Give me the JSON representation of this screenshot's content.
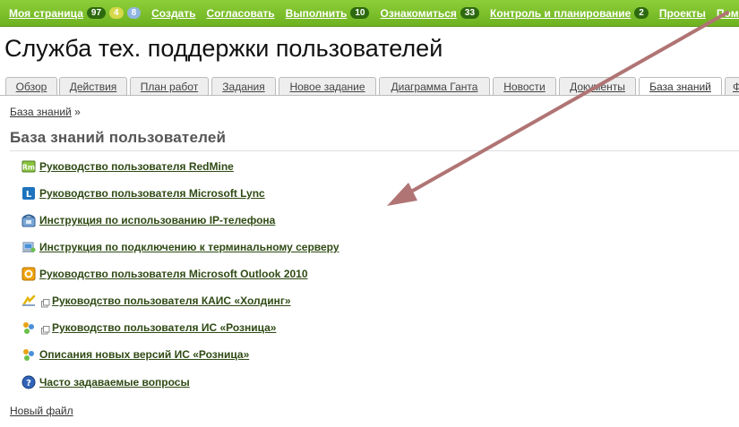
{
  "topbar": {
    "items": [
      {
        "label": "Моя страница",
        "badges": [
          {
            "value": "97",
            "color": "#2d6a0f"
          },
          {
            "value": "4",
            "color": "#d5d94a"
          },
          {
            "value": "8",
            "color": "#8fb6e0"
          }
        ]
      },
      {
        "label": "Создать",
        "badges": []
      },
      {
        "label": "Согласовать",
        "badges": []
      },
      {
        "label": "Выполнить",
        "badges": [
          {
            "value": "10",
            "color": "#2d6a0f"
          }
        ]
      },
      {
        "label": "Ознакомиться",
        "badges": [
          {
            "value": "33",
            "color": "#2d6a0f"
          }
        ]
      },
      {
        "label": "Контроль и планирование",
        "badges": [
          {
            "value": "2",
            "color": "#2d6a0f"
          }
        ]
      },
      {
        "label": "Проекты",
        "badges": []
      },
      {
        "label": "Помощь",
        "badges": []
      }
    ]
  },
  "header": {
    "title": "Служба тех. поддержки пользователей"
  },
  "tabs": [
    {
      "label": "Обзор",
      "selected": false
    },
    {
      "label": "Действия",
      "selected": false
    },
    {
      "label": "План работ",
      "selected": false
    },
    {
      "label": "Задания",
      "selected": false
    },
    {
      "label": "Новое задание",
      "selected": false
    },
    {
      "label": "Диаграмма Ганта",
      "selected": false
    },
    {
      "label": "Новости",
      "selected": false
    },
    {
      "label": "Документы",
      "selected": false
    },
    {
      "label": "База знаний",
      "selected": true
    },
    {
      "label": "Ф",
      "selected": false
    }
  ],
  "breadcrumb": {
    "link": "База знаний",
    "separator": "»"
  },
  "section": {
    "title": "База знаний пользователей"
  },
  "documents": [
    {
      "label": "Руководство пользователя RedMine",
      "icon": "redmine-icon",
      "external": false
    },
    {
      "label": "Руководство пользователя Microsoft Lync",
      "icon": "lync-icon",
      "external": false
    },
    {
      "label": "Инструкция по использованию IP-телефона",
      "icon": "phone-icon",
      "external": false
    },
    {
      "label": "Инструкция по подключению к терминальному серверу",
      "icon": "terminal-server-icon",
      "external": false
    },
    {
      "label": "Руководство пользователя Microsoft Outlook 2010",
      "icon": "outlook-icon",
      "external": false
    },
    {
      "label": "Руководство пользователя КАИС «Холдинг»",
      "icon": "kais-icon",
      "external": true
    },
    {
      "label": "Руководство пользователя ИС «Розница»",
      "icon": "retail-icon",
      "external": true
    },
    {
      "label": "Описания новых версий ИС «Розница»",
      "icon": "retail-icon",
      "external": false
    },
    {
      "label": "Часто задаваемые вопросы",
      "icon": "help-icon",
      "external": false
    }
  ],
  "new_file": {
    "label": "Новый файл"
  },
  "colors": {
    "accent": "#7abf2b",
    "link": "#2f4a14",
    "arrow": "#b07474"
  }
}
